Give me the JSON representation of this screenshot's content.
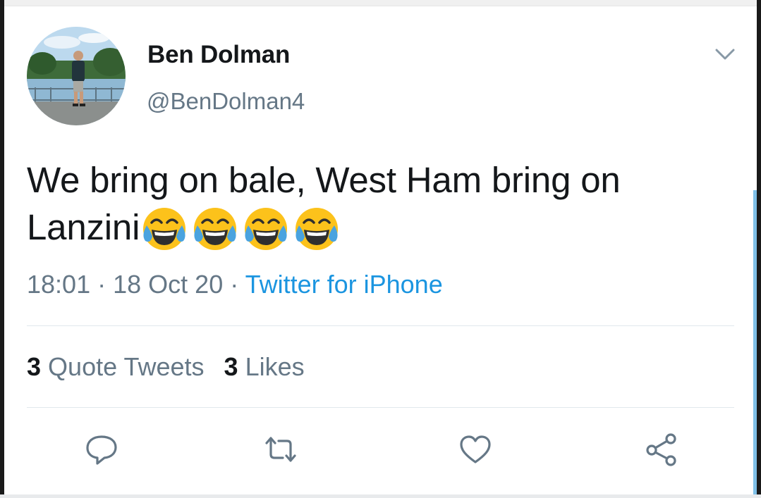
{
  "tweet": {
    "author_name": "Ben Dolman",
    "author_handle": "@BenDolman4",
    "text_line1": "We bring on bale, West Ham bring on",
    "text_line2": "Lanzini",
    "emoji": [
      "face-with-tears-of-joy",
      "face-with-tears-of-joy",
      "face-with-tears-of-joy",
      "face-with-tears-of-joy"
    ],
    "time": "18:01",
    "separator": "·",
    "date": "18 Oct 20",
    "source": "Twitter for iPhone"
  },
  "stats": {
    "quote_tweets_count": "3",
    "quote_tweets_label": "Quote Tweets",
    "likes_count": "3",
    "likes_label": "Likes"
  },
  "actions": [
    "reply-icon",
    "retweet-icon",
    "like-icon",
    "share-icon"
  ],
  "colors": {
    "text_primary": "#14171a",
    "text_secondary": "#657786",
    "link": "#1b95e0",
    "divider": "#e1e8ed",
    "emoji_face": "#fcc21b",
    "emoji_tears": "#4aa3df"
  }
}
